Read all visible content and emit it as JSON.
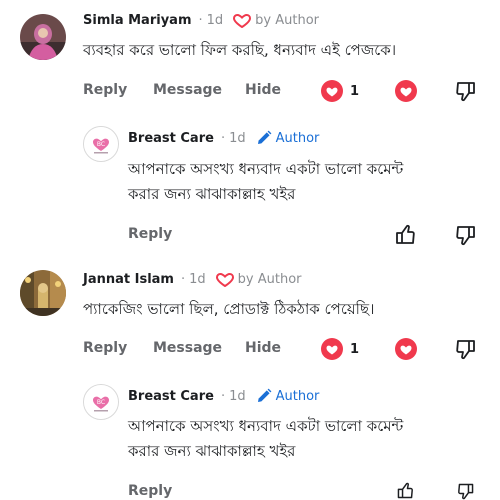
{
  "comments": [
    {
      "name": "Simla Mariyam",
      "time": "1d",
      "author_tag": "by Author",
      "text": "ব্যবহার করে ভালো ফিল করছি, ধন্যবাদ এই পেজকে।",
      "actions": {
        "reply": "Reply",
        "message": "Message",
        "hide": "Hide"
      },
      "like_count": "1",
      "reply": {
        "name": "Breast Care",
        "time": "1d",
        "author_tag": "Author",
        "text_line1": "আপনাকে অসংখ্য ধন্যবাদ একটা ভালো কমেন্ট",
        "text_line2": "করার জন্য ঝাঝাকাল্লাহ খইর",
        "reply_label": "Reply"
      }
    },
    {
      "name": "Jannat Islam",
      "time": "1d",
      "author_tag": "by Author",
      "text": "প্যাকেজিং ভালো ছিল, প্রোডাক্ট ঠিকঠাক পেয়েছি।",
      "actions": {
        "reply": "Reply",
        "message": "Message",
        "hide": "Hide"
      },
      "like_count": "1",
      "reply": {
        "name": "Breast Care",
        "time": "1d",
        "author_tag": "Author",
        "text_line1": "আপনাকে অসংখ্য ধন্যবাদ একটা ভালো কমেন্ট",
        "text_line2": "করার জন্য ঝাঝাকাল্লাহ খইর",
        "reply_label": "Reply"
      }
    }
  ],
  "colors": {
    "accent_blue": "#1a6fd6",
    "love_red": "#f0394d",
    "muted": "#65676b"
  },
  "icons": [
    "love-outline-icon",
    "pencil-icon",
    "love-reaction-icon",
    "thumbs-up-icon",
    "thumbs-down-icon"
  ]
}
